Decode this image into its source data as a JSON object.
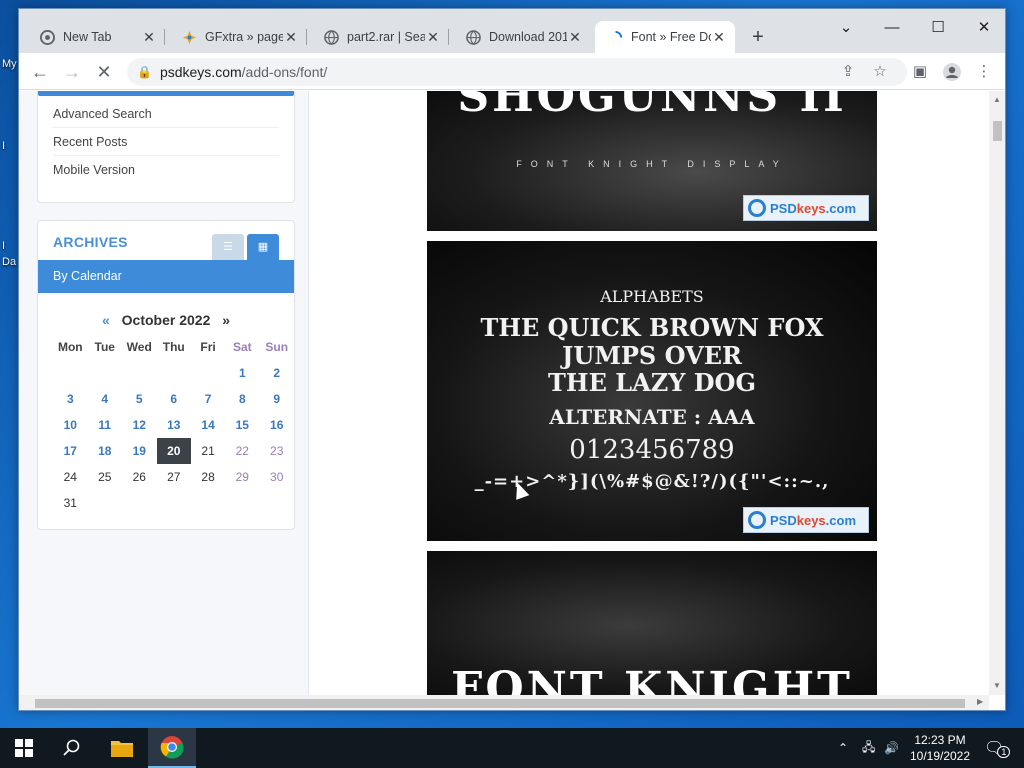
{
  "desktop": {
    "icon_labels": [
      "My",
      "I",
      "I",
      "Da"
    ]
  },
  "browser": {
    "tabs": [
      {
        "title": "New Tab",
        "icon": "chrome-icon"
      },
      {
        "title": "GFxtra » page",
        "icon": "gfxtra-icon"
      },
      {
        "title": "part2.rar | Sear",
        "icon": "globe-icon"
      },
      {
        "title": "Download 201",
        "icon": "globe-icon"
      },
      {
        "title": "Font » Free Do",
        "icon": "loading-icon"
      }
    ],
    "new_tab_label": "+",
    "url_domain": "psdkeys.com",
    "url_path": "/add-ons/font/"
  },
  "sidebar": {
    "links": [
      "Advanced Search",
      "Recent Posts",
      "Mobile Version"
    ],
    "archives_title": "ARCHIVES",
    "by_calendar": "By Calendar",
    "calendar": {
      "prev": "«",
      "month": "October 2022",
      "next": "»",
      "days": [
        "Mon",
        "Tue",
        "Wed",
        "Thu",
        "Fri",
        "Sat",
        "Sun"
      ],
      "weeks": [
        [
          "",
          "",
          "",
          "",
          "",
          "1",
          "2"
        ],
        [
          "3",
          "4",
          "5",
          "6",
          "7",
          "8",
          "9"
        ],
        [
          "10",
          "11",
          "12",
          "13",
          "14",
          "15",
          "16"
        ],
        [
          "17",
          "18",
          "19",
          "20",
          "21",
          "22",
          "23"
        ],
        [
          "24",
          "25",
          "26",
          "27",
          "28",
          "29",
          "30"
        ],
        [
          "31",
          "",
          "",
          "",
          "",
          "",
          ""
        ]
      ],
      "today": "20"
    }
  },
  "previews": {
    "p1_title": "SHOGUNNS II",
    "p1_sub": "FONT KNIGHT DISPLAY",
    "p2_lines": [
      "ALPHABETS",
      "THE QUICK BROWN FOX",
      "JUMPS OVER",
      "THE LAZY DOG",
      "ALTERNATE : AAA",
      "0123456789",
      "_-=+>^*}](\\%#$@&!?/)({\"'<::~.,"
    ],
    "p3_title": "FONT KNIGHT",
    "badge_psd": "PSD",
    "badge_keys": "keys",
    "badge_com": ".com"
  },
  "taskbar": {
    "time": "12:23 PM",
    "date": "10/19/2022",
    "notifications": "1"
  }
}
